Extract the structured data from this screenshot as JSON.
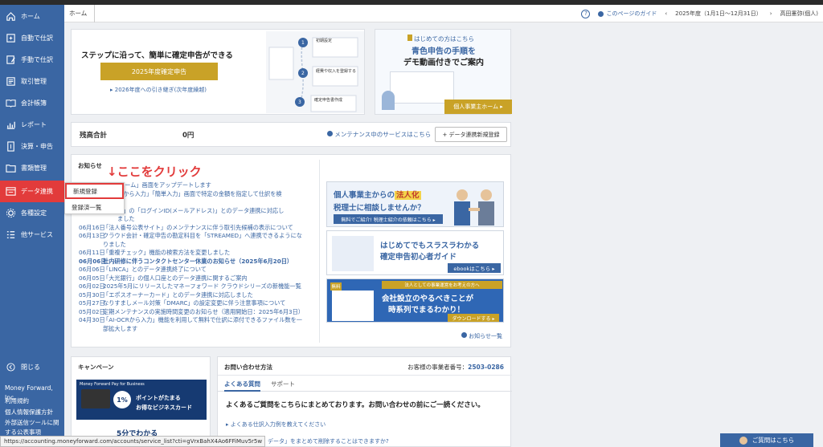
{
  "sidebar": {
    "items": [
      {
        "label": "ホーム",
        "icon": "home-icon"
      },
      {
        "label": "自動で仕訳",
        "icon": "auto-journal-icon"
      },
      {
        "label": "手動で仕訳",
        "icon": "manual-journal-icon"
      },
      {
        "label": "取引管理",
        "icon": "transaction-icon"
      },
      {
        "label": "会計帳簿",
        "icon": "ledger-icon"
      },
      {
        "label": "レポート",
        "icon": "report-icon"
      },
      {
        "label": "決算・申告",
        "icon": "tax-return-icon"
      },
      {
        "label": "書類管理",
        "icon": "folder-icon"
      },
      {
        "label": "データ連携",
        "icon": "data-link-icon"
      },
      {
        "label": "各種設定",
        "icon": "gear-icon"
      },
      {
        "label": "他サービス",
        "icon": "grid-icon"
      }
    ],
    "close_label": "閉じる",
    "company": "Money Forward, Inc.",
    "footer_links": [
      "利用規約",
      "個人情報保護方針",
      "外部送信ツールに関",
      "する公表事項"
    ]
  },
  "header": {
    "breadcrumb": "ホーム",
    "guide": "このページのガイド",
    "fiscal_year": "2025年度（1月1日〜12月31日）",
    "user": "高田憲弥(個人)"
  },
  "hero": {
    "title": "ステップに沿って、簡単に確定申告ができる",
    "button": "2025年度確定申告",
    "sublink": "2026年度への引き継ぎ(次年度繰越)",
    "steps": [
      "初期設定",
      "経費や収入を登録する",
      "確定申告書作成"
    ]
  },
  "beginner": {
    "small": "はじめての方はこちら",
    "title1": "青色申告の手順を",
    "title2": "デモ動画付きでご案内",
    "button": "個人事業主ホーム ▸"
  },
  "balance": {
    "label": "残高合計",
    "value": "0円",
    "maintenance": "メンテナンス中のサービスはこちら",
    "new_link_button": "+ データ連携新規登録"
  },
  "news": {
    "title": "お知らせ",
    "lines": [
      {
        "date": "",
        "text": "ホーム」画面をアップデートします",
        "bold": false
      },
      {
        "date": "",
        "text": "スから入力」「簡単入力」画面で特定の金額を指定して仕訳を検",
        "bold": false
      },
      {
        "date": "",
        "text": "た",
        "bold": false
      },
      {
        "date": "",
        "text": "部」の「ログインID(メールアドレス)」とのデータ連携に対応し",
        "bold": false
      },
      {
        "date": "",
        "text": "ました",
        "bold": false
      },
      {
        "date": "06月16日",
        "text": "「法人番号公表サイト」のメンテナンスに伴う取引先候補の表示について",
        "bold": false
      },
      {
        "date": "06月13日",
        "text": "クラウド会計・確定申告の勘定科目を「STREAMED」へ連携できるようにな",
        "bold": false
      },
      {
        "date": "",
        "text": "りました",
        "bold": false
      },
      {
        "date": "06月11日",
        "text": "「重複チェック」機能の検索方法を変更しました",
        "bold": false
      },
      {
        "date": "06月06日",
        "text": "社内研修に伴うコンタクトセンター休業のお知らせ（2025年6月20日）",
        "bold": true
      },
      {
        "date": "06月06日",
        "text": "「LINCA」とのデータ連携終了について",
        "bold": false
      },
      {
        "date": "06月05日",
        "text": "「大光銀行」の個人口座とのデータ連携に関するご案内",
        "bold": false
      },
      {
        "date": "06月02日",
        "text": "2025年5月にリリースしたマネーフォワード クラウドシリーズの新機能一覧",
        "bold": false
      },
      {
        "date": "05月30日",
        "text": "「エポスオーナーカード」とのデータ連携に対応しました",
        "bold": false
      },
      {
        "date": "05月27日",
        "text": "なりすましメール対策「DMARC」の設定変更に伴う注意事項について",
        "bold": false
      },
      {
        "date": "05月02日",
        "text": "定期メンテナンスの実施時間変更のお知らせ（適用開始日：2025年6月3日）",
        "bold": false
      },
      {
        "date": "04月30日",
        "text": "「AI-OCRから入力」機能を利用して無料で仕訳に添付できるファイル数を一",
        "bold": false
      },
      {
        "date": "",
        "text": "部拡大します",
        "bold": false
      }
    ],
    "more": "お知らせ一覧"
  },
  "banners": {
    "b1_line1": "個人事業主からの",
    "b1_hl": "法人化",
    "b1_line2": "税理士に相談しませんか？",
    "b1_btn": "無料でご紹介! 税理士紹介の依頼はこちら ▸",
    "b2_line1": "はじめてでもスラスラわかる",
    "b2_line2": "確定申告初心者ガイド",
    "b2_btn": "ebookはこちら ▸",
    "b3_top": "法人としての事業運営をお考えの方へ",
    "b3_line1": "会社設立のやるべきことが",
    "b3_line2": "時系列でまるわかり！",
    "b3_btn": "ダウンロードする ▸",
    "b3_tag": "無料"
  },
  "campaign": {
    "title": "キャンペーン",
    "card_brand": "Money Forward Pay for Business",
    "card_text1": "ポイントがたまる",
    "card_text2": "お得なビジネスカード",
    "percent": "1%",
    "footer": "5分でわかる"
  },
  "contact": {
    "title": "お問い合わせ方法",
    "customer_no_label": "お客様の事業者番号：",
    "customer_no": "2503-0286",
    "tabs": [
      "よくある質問",
      "サポート"
    ],
    "intro": "よくあるご質問をこちらにまとめております。お問い合わせの前にご一読ください。",
    "faq1": "よくある仕訳入力例を教えてください",
    "faq2": "データ」をまとめて削除することはできますか?"
  },
  "dropdown": {
    "items": [
      "新規登録",
      "登録済一覧"
    ]
  },
  "annotation": "↓ここをクリック",
  "status_url": "https://accounting.moneyforward.com/accounts/service_list?cti=gVrxBahX4Ao6FFiMuv5r5w",
  "help_button": "ご質問はこちら",
  "colors": {
    "brand": "#3a66a3",
    "gold": "#c9a227",
    "highlight": "#e23b3b"
  }
}
